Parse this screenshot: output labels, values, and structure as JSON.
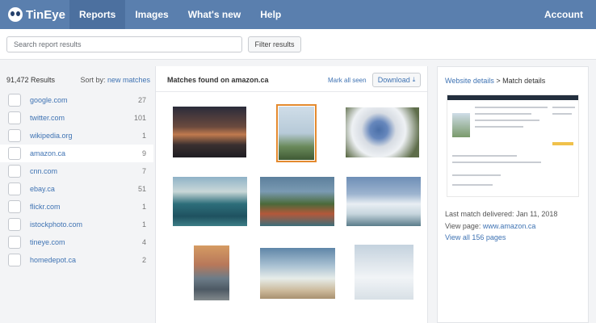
{
  "nav": {
    "logo": "TinEye",
    "items": [
      {
        "label": "Reports",
        "active": true
      },
      {
        "label": "Images",
        "active": false
      },
      {
        "label": "What's new",
        "active": false
      },
      {
        "label": "Help",
        "active": false
      }
    ],
    "account": "Account"
  },
  "search": {
    "placeholder": "Search report results",
    "filter_label": "Filter results"
  },
  "sidebar": {
    "total": "91,472 Results",
    "sort_label": "Sort by:",
    "sort_value": "new matches",
    "domains": [
      {
        "name": "google.com",
        "count": "27",
        "active": false
      },
      {
        "name": "twitter.com",
        "count": "101",
        "active": false
      },
      {
        "name": "wikipedia.org",
        "count": "1",
        "active": false
      },
      {
        "name": "amazon.ca",
        "count": "9",
        "active": true
      },
      {
        "name": "cnn.com",
        "count": "7",
        "active": false
      },
      {
        "name": "ebay.ca",
        "count": "51",
        "active": false
      },
      {
        "name": "flickr.com",
        "count": "1",
        "active": false
      },
      {
        "name": "istockphoto.com",
        "count": "1",
        "active": false
      },
      {
        "name": "tineye.com",
        "count": "4",
        "active": false
      },
      {
        "name": "homedepot.ca",
        "count": "2",
        "active": false
      }
    ]
  },
  "matches": {
    "title": "Matches found on amazon.ca",
    "mark_all_seen": "Mark all seen",
    "download_label": "Download",
    "selected_index": 1
  },
  "detail": {
    "breadcrumb_link": "Website details",
    "breadcrumb_sep": ">",
    "breadcrumb_current": "Match details",
    "last_match_label": "Last match delivered:",
    "last_match_date": "Jan 11, 2018",
    "view_page_label": "View page:",
    "view_page_url": "www.amazon.ca",
    "view_all": "View all 156 pages"
  }
}
